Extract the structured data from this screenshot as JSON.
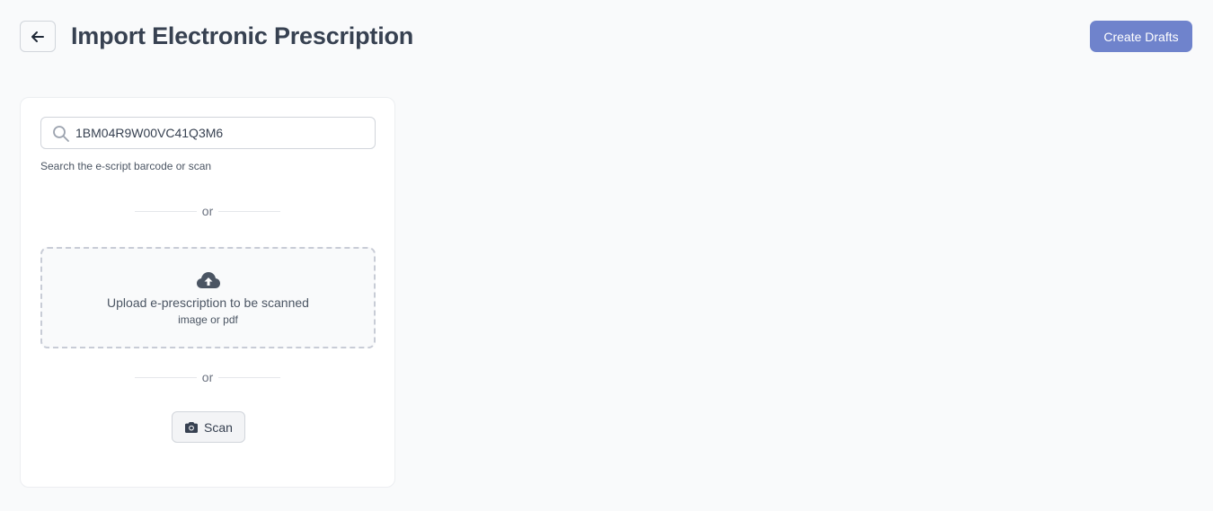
{
  "header": {
    "title": "Import Electronic Prescription",
    "back_icon": "arrow-left-icon",
    "create_drafts_label": "Create Drafts"
  },
  "search": {
    "icon": "search-icon",
    "value": "1BM04R9W00VC41Q3M6",
    "hint": "Search the e-script barcode or scan"
  },
  "divider_text": "or",
  "upload": {
    "icon": "cloud-upload-icon",
    "title": "Upload e-prescription to be scanned",
    "subtitle": "image or pdf"
  },
  "scan": {
    "icon": "camera-icon",
    "label": "Scan"
  },
  "colors": {
    "background": "#f9fafb",
    "primary_button": "#6f83cc",
    "title_text": "#374151",
    "card": "#ffffff"
  }
}
